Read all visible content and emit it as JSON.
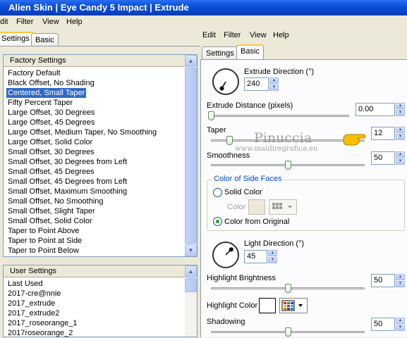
{
  "window": {
    "title": "Alien Skin | Eye Candy 5 Impact | Extrude"
  },
  "left_menu": [
    "dit",
    "Filter",
    "View",
    "Help"
  ],
  "right_menu": [
    "Edit",
    "Filter",
    "View",
    "Help"
  ],
  "left_tabs": [
    "Settings",
    "Basic"
  ],
  "right_tabs": [
    "Settings",
    "Basic"
  ],
  "factory_settings": {
    "header": "Factory Settings",
    "selected": "Centered, Small Taper",
    "items": [
      "Factory Default",
      "Black Offset, No Shading",
      "Centered, Small Taper",
      "Fifty Percent Taper",
      "Large Offset, 30 Degrees",
      "Large Offset, 45 Degrees",
      "Large Offset, Medium Taper, No Smoothing",
      "Large Offset, Solid Color",
      "Small Offset, 30 Degrees",
      "Small Offset, 30 Degrees from Left",
      "Small Offset, 45 Degrees",
      "Small Offset, 45 Degrees from Left",
      "Small Offset, Maximum Smoothing",
      "Small Offset, No Smoothing",
      "Small Offset, Slight Taper",
      "Small Offset, Solid Color",
      "Taper to Point Above",
      "Taper to Point at Side",
      "Taper to Point Below"
    ]
  },
  "user_settings": {
    "header": "User Settings",
    "items": [
      "Last Used",
      "2017-cre@nnie",
      "2017_extrude",
      "2017_extrude2",
      "2017_roseorange_1",
      "2017roseorange_2"
    ]
  },
  "controls": {
    "extrude_direction": {
      "label": "Extrude Direction (°)",
      "value": "240",
      "angle": 240
    },
    "extrude_distance": {
      "label": "Extrude Distance (pixels)",
      "value": "0.00",
      "fraction": 0.0
    },
    "taper": {
      "label": "Taper",
      "value": "12",
      "fraction": 0.12
    },
    "smoothness": {
      "label": "Smoothness",
      "value": "50",
      "fraction": 0.5
    },
    "color_of_side_faces": {
      "title": "Color of Side Faces",
      "solid_color_label": "Solid Color",
      "color_label": "Color",
      "color_from_original_label": "Color from Original",
      "selected": "Color from Original"
    },
    "light_direction": {
      "label": "Light Direction (°)",
      "value": "45",
      "angle": 45
    },
    "highlight_brightness": {
      "label": "Highlight Brightness",
      "value": "50",
      "fraction": 0.5
    },
    "highlight_color": {
      "label": "Highlight Color",
      "color": "#ffffff"
    },
    "shadowing": {
      "label": "Shadowing",
      "value": "50",
      "fraction": 0.5
    }
  },
  "watermark": {
    "line1": "Pinuccia",
    "line2": "www.maidiregrafica.eu"
  },
  "colors": {
    "titlebar": "#0a4fd8",
    "selection": "#316ac5",
    "group_title": "#0046d5"
  }
}
